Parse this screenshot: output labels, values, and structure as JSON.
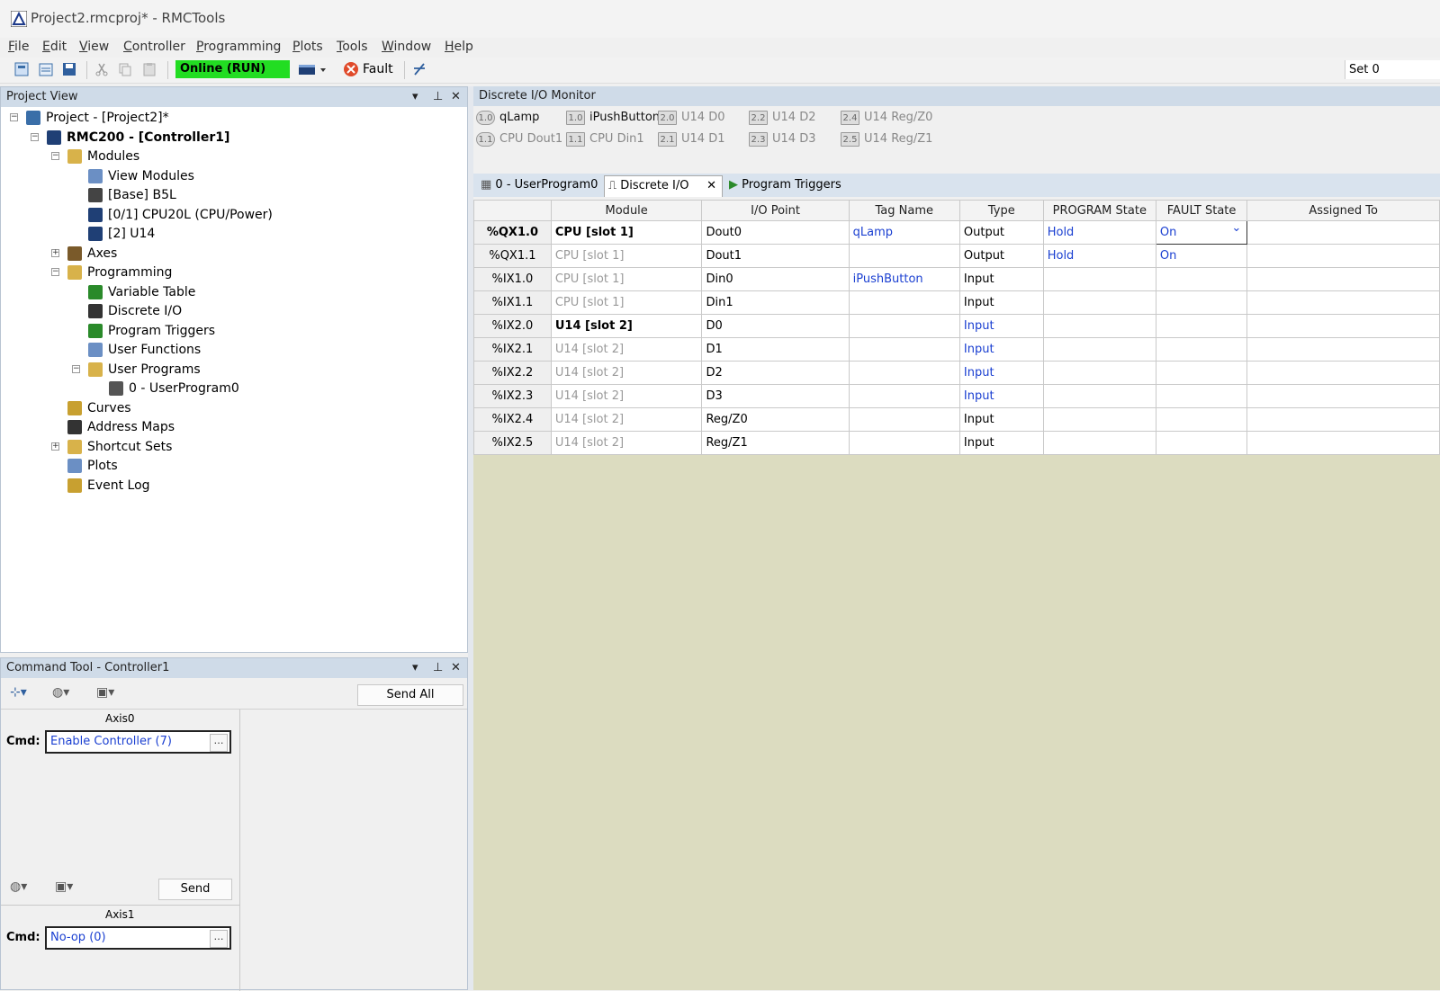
{
  "window": {
    "title": "Project2.rmcproj* - RMCTools"
  },
  "menu": [
    "File",
    "Edit",
    "View",
    "Controller",
    "Programming",
    "Plots",
    "Tools",
    "Window",
    "Help"
  ],
  "toolbar": {
    "status": "Online (RUN)",
    "fault_label": "Fault",
    "set_label": "Set 0"
  },
  "project_view": {
    "title": "Project View",
    "items": [
      {
        "label": "Project - [Project2]*",
        "level": 0,
        "icon": "project-icon"
      },
      {
        "label": "RMC200 - [Controller1]",
        "level": 1,
        "icon": "controller-icon",
        "bold": true
      },
      {
        "label": "Modules",
        "level": 2,
        "icon": "folder-icon"
      },
      {
        "label": "View Modules",
        "level": 3,
        "icon": "view-modules-icon"
      },
      {
        "label": "[Base] B5L",
        "level": 3,
        "icon": "base-icon"
      },
      {
        "label": "[0/1] CPU20L (CPU/Power)",
        "level": 3,
        "icon": "cpu-module-icon"
      },
      {
        "label": "[2] U14",
        "level": 3,
        "icon": "io-module-icon"
      },
      {
        "label": "Axes",
        "level": 2,
        "icon": "axes-icon"
      },
      {
        "label": "Programming",
        "level": 2,
        "icon": "folder-icon"
      },
      {
        "label": "Variable Table",
        "level": 3,
        "icon": "variable-table-icon"
      },
      {
        "label": "Discrete I/O",
        "level": 3,
        "icon": "discrete-io-icon"
      },
      {
        "label": "Program Triggers",
        "level": 3,
        "icon": "program-triggers-icon"
      },
      {
        "label": "User Functions",
        "level": 3,
        "icon": "user-functions-icon"
      },
      {
        "label": "User Programs",
        "level": 3,
        "icon": "folder-icon"
      },
      {
        "label": "0 - UserProgram0",
        "level": 4,
        "icon": "user-program-icon"
      },
      {
        "label": "Curves",
        "level": 2,
        "icon": "curves-icon"
      },
      {
        "label": "Address Maps",
        "level": 2,
        "icon": "address-maps-icon"
      },
      {
        "label": "Shortcut Sets",
        "level": 2,
        "icon": "shortcut-sets-icon"
      },
      {
        "label": "Plots",
        "level": 2,
        "icon": "plots-icon"
      },
      {
        "label": "Event Log",
        "level": 2,
        "icon": "event-log-icon"
      }
    ]
  },
  "command_tool": {
    "title": "Command Tool - Controller1",
    "send_all": "Send All",
    "send": "Send",
    "axes": [
      {
        "name": "Axis0",
        "cmd_label": "Cmd:",
        "cmd_value": "Enable Controller (7)"
      },
      {
        "name": "Axis1",
        "cmd_label": "Cmd:",
        "cmd_value": "No-op (0)"
      }
    ]
  },
  "monitor": {
    "title": "Discrete I/O Monitor",
    "leds": [
      {
        "code": "1.0",
        "label": "qLamp",
        "round": true,
        "dim": false
      },
      {
        "code": "1.1",
        "label": "CPU Dout1",
        "round": true,
        "dim": true
      },
      {
        "code": "1.0",
        "label": "iPushButton",
        "round": false,
        "dim": false
      },
      {
        "code": "1.1",
        "label": "CPU Din1",
        "round": false,
        "dim": true
      },
      {
        "code": "2.0",
        "label": "U14 D0",
        "round": false,
        "dim": true
      },
      {
        "code": "2.1",
        "label": "U14 D1",
        "round": false,
        "dim": true
      },
      {
        "code": "2.2",
        "label": "U14 D2",
        "round": false,
        "dim": true
      },
      {
        "code": "2.3",
        "label": "U14 D3",
        "round": false,
        "dim": true
      },
      {
        "code": "2.4",
        "label": "U14 Reg/Z0",
        "round": false,
        "dim": true
      },
      {
        "code": "2.5",
        "label": "U14 Reg/Z1",
        "round": false,
        "dim": true
      }
    ]
  },
  "tabs": [
    {
      "label": "0 - UserProgram0",
      "active": false
    },
    {
      "label": "Discrete I/O",
      "active": true
    },
    {
      "label": "Program Triggers",
      "active": false
    }
  ],
  "grid": {
    "columns": [
      "",
      "Module",
      "I/O Point",
      "Tag Name",
      "Type",
      "PROGRAM State",
      "FAULT State",
      "Assigned To"
    ],
    "rows": [
      {
        "addr": "%QX1.0",
        "module": "CPU [slot 1]",
        "point": "Dout0",
        "tag": "qLamp",
        "type": "Output",
        "prog": "Hold",
        "fault": "On",
        "assigned": ""
      },
      {
        "addr": "%QX1.1",
        "module": "CPU [slot 1]",
        "point": "Dout1",
        "tag": "",
        "type": "Output",
        "prog": "Hold",
        "fault": "On",
        "assigned": ""
      },
      {
        "addr": "%IX1.0",
        "module": "CPU [slot 1]",
        "point": "Din0",
        "tag": "iPushButton",
        "type": "Input",
        "prog": "",
        "fault": "",
        "assigned": ""
      },
      {
        "addr": "%IX1.1",
        "module": "CPU [slot 1]",
        "point": "Din1",
        "tag": "",
        "type": "Input",
        "prog": "",
        "fault": "",
        "assigned": ""
      },
      {
        "addr": "%IX2.0",
        "module": "U14 [slot 2]",
        "point": "D0",
        "tag": "",
        "type": "Input",
        "prog": "",
        "fault": "",
        "assigned": ""
      },
      {
        "addr": "%IX2.1",
        "module": "U14 [slot 2]",
        "point": "D1",
        "tag": "",
        "type": "Input",
        "prog": "",
        "fault": "",
        "assigned": ""
      },
      {
        "addr": "%IX2.2",
        "module": "U14 [slot 2]",
        "point": "D2",
        "tag": "",
        "type": "Input",
        "prog": "",
        "fault": "",
        "assigned": ""
      },
      {
        "addr": "%IX2.3",
        "module": "U14 [slot 2]",
        "point": "D3",
        "tag": "",
        "type": "Input",
        "prog": "",
        "fault": "",
        "assigned": ""
      },
      {
        "addr": "%IX2.4",
        "module": "U14 [slot 2]",
        "point": "Reg/Z0",
        "tag": "",
        "type": "Input",
        "prog": "",
        "fault": "",
        "assigned": ""
      },
      {
        "addr": "%IX2.5",
        "module": "U14 [slot 2]",
        "point": "Reg/Z1",
        "tag": "",
        "type": "Input",
        "prog": "",
        "fault": "",
        "assigned": ""
      }
    ]
  },
  "colors": {
    "online": "#22dd22",
    "link_blue": "#1a3fd1",
    "grid_bg": "#dcdcc0",
    "panel_header": "#cfdbe8"
  }
}
